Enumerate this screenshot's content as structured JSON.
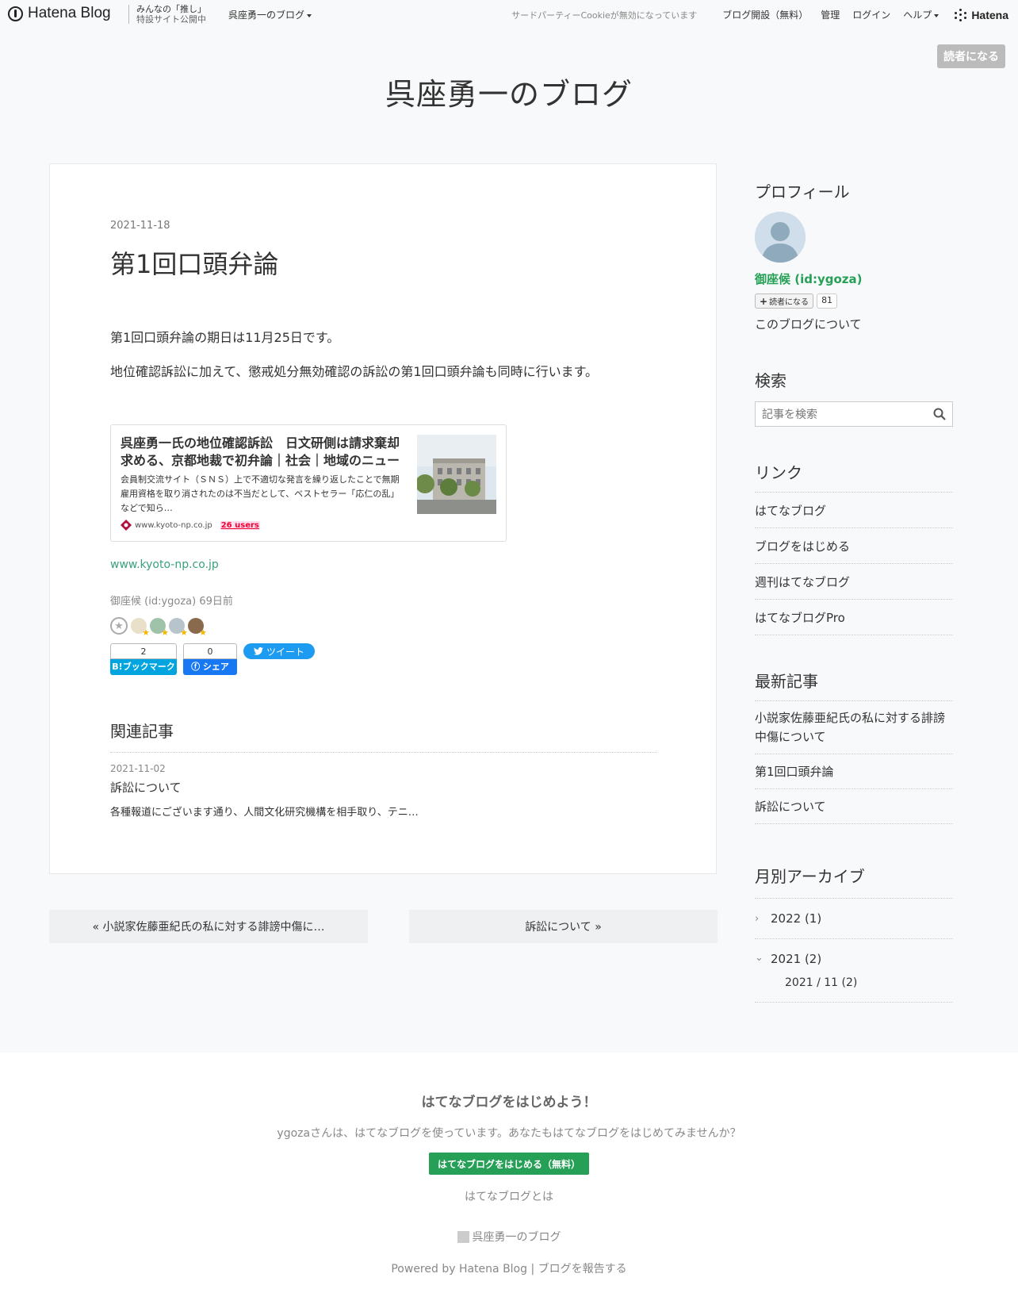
{
  "topbar": {
    "logo_text": "Hatena Blog",
    "promo_line1": "みんなの「推し」",
    "promo_line2": "特設サイト公開中",
    "blog_menu": "呉座勇一のブログ",
    "cookie_notice": "サードパーティーCookieが無効になっています",
    "open_blog": "ブログ開設（無料）",
    "manage": "管理",
    "login": "ログイン",
    "help": "ヘルプ",
    "brand": "Hatena"
  },
  "subscribe_button": "読者になる",
  "blog_title": "呉座勇一のブログ",
  "entry": {
    "date": "2021-11-18",
    "title": "第1回口頭弁論",
    "paragraphs": [
      "第1回口頭弁論の期日は11月25日です。",
      "地位確認訴訟に加えて、懲戒処分無効確認の訴訟の第1回口頭弁論も同時に行います。"
    ],
    "embed": {
      "title": "呉座勇一氏の地位確認訴訟　日文研側は請求棄却求める、京都地裁で初弁論｜社会｜地域のニュース｜京都新聞",
      "description": "会員制交流サイト（ＳＮＳ）上で不適切な発言を繰り返したことで無期雇用資格を取り消されたのは不当だとして、ベストセラー「応仁の乱」などで知ら…",
      "domain": "www.kyoto-np.co.jp",
      "users": "26 users"
    },
    "source_link": "www.kyoto-np.co.jp",
    "byline": "御座候 (id:ygoza) 69日前",
    "share": {
      "hatebu_count": "2",
      "hatebu_label": "B!ブックマーク",
      "fb_count": "0",
      "fb_label": "シェア",
      "tweet_label": "ツイート"
    },
    "related": {
      "heading": "関連記事",
      "date": "2021-11-02",
      "title": "訴訟について",
      "snippet": "各種報道にございます通り、人間文化研究機構を相手取り、テニ…"
    }
  },
  "pager": {
    "prev": "« 小説家佐藤亜紀氏の私に対する誹謗中傷に…",
    "next": "訴訟について »"
  },
  "sidebar": {
    "profile_heading": "プロフィール",
    "profile_name": "御座候 (id:ygoza)",
    "subscribe_mini": "読者になる",
    "subscriber_count": "81",
    "about": "このブログについて",
    "search_heading": "検索",
    "search_placeholder": "記事を検索",
    "links_heading": "リンク",
    "links": [
      "はてなブログ",
      "ブログをはじめる",
      "週刊はてなブログ",
      "はてなブログPro"
    ],
    "recent_heading": "最新記事",
    "recent": [
      "小説家佐藤亜紀氏の私に対する誹謗中傷について",
      "第1回口頭弁論",
      "訴訟について"
    ],
    "archive_heading": "月別アーカイブ",
    "archive": [
      {
        "chevron": "›",
        "label": "2022 (1)"
      },
      {
        "chevron": "⌄",
        "label": "2021 (2)"
      }
    ],
    "archive_sub": "2021 / 11 (2)"
  },
  "footer": {
    "title": "はてなブログをはじめよう！",
    "desc": "ygozaさんは、はてなブログを使っています。あなたもはてなブログをはじめてみませんか？",
    "start_button": "はてなブログをはじめる（無料）",
    "about": "はてなブログとは",
    "blog_name": "呉座勇一のブログ",
    "powered": "Powered by Hatena Blog | ブログを報告する"
  }
}
